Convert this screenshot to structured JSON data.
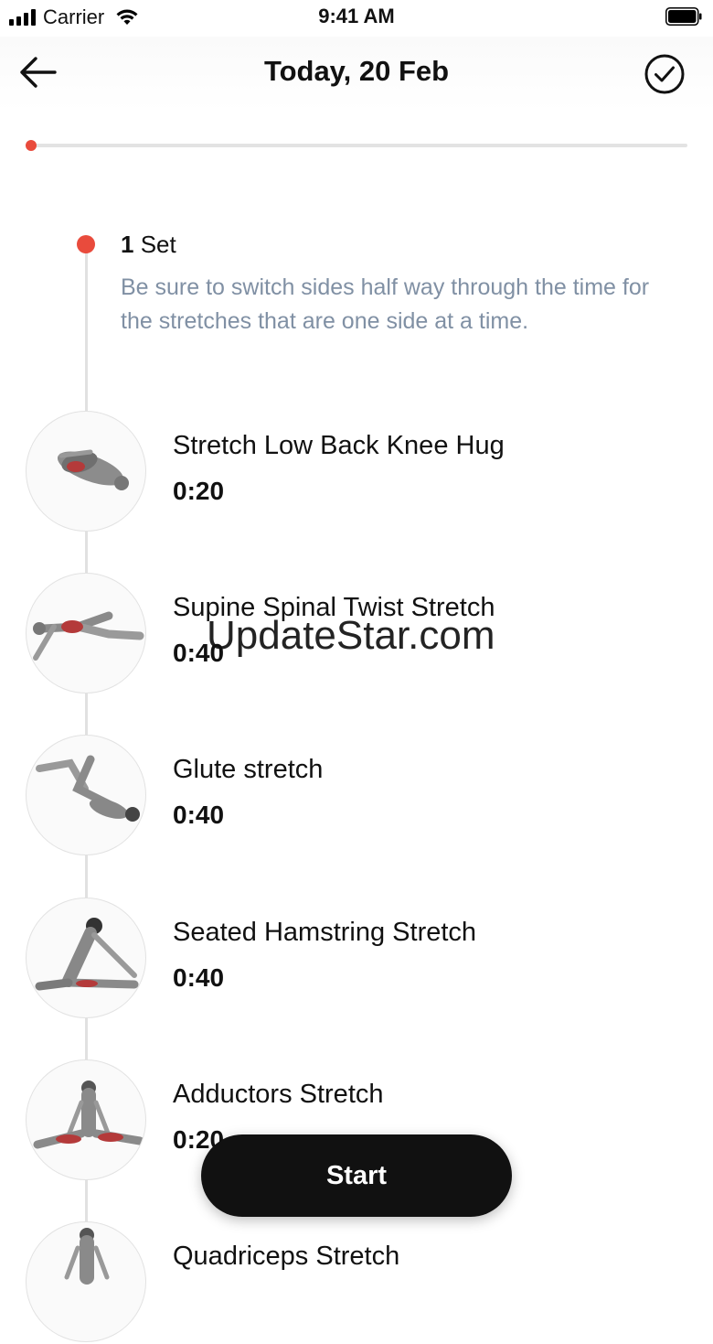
{
  "status_bar": {
    "carrier": "Carrier",
    "time": "9:41 AM"
  },
  "header": {
    "title": "Today, 20 Feb",
    "back_icon": "arrow-left-icon",
    "done_icon": "check-circle-icon"
  },
  "progress": {
    "current": 0,
    "accent_color": "#e94b3c"
  },
  "set": {
    "number": "1",
    "label": "Set",
    "note": "Be sure to switch sides half way through the time for the stretches that are one side at a time."
  },
  "exercises": [
    {
      "name": "Stretch Low Back Knee Hug",
      "duration": "0:20"
    },
    {
      "name": "Supine Spinal Twist Stretch",
      "duration": "0:40"
    },
    {
      "name": "Glute stretch",
      "duration": "0:40"
    },
    {
      "name": "Seated Hamstring Stretch",
      "duration": "0:40"
    },
    {
      "name": "Adductors Stretch",
      "duration": "0:20"
    },
    {
      "name": "Quadriceps Stretch",
      "duration": ""
    }
  ],
  "watermark": "UpdateStar.com",
  "start_button": {
    "label": "Start"
  }
}
